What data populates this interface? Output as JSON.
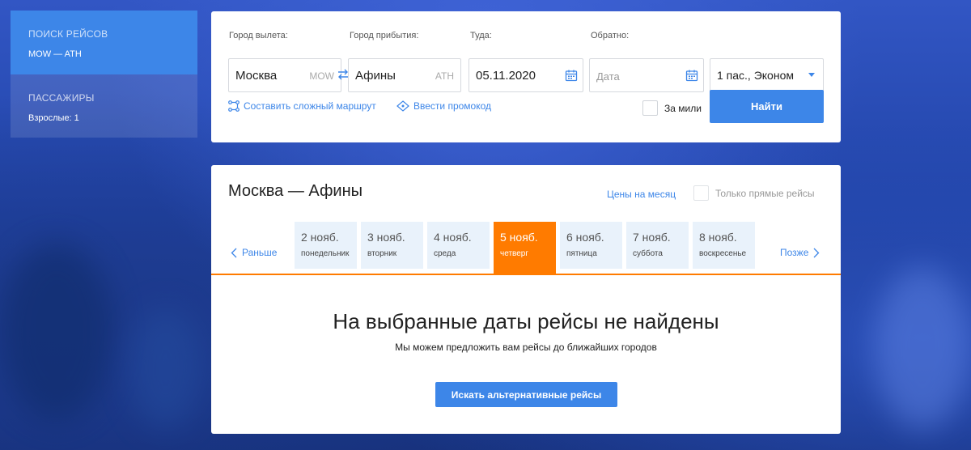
{
  "sidebar": {
    "search": {
      "title": "ПОИСК РЕЙСОВ",
      "route": "MOW — ATH"
    },
    "passengers": {
      "title": "ПАССАЖИРЫ",
      "adults": "Взрослые: 1"
    }
  },
  "search": {
    "from_label": "Город вылета:",
    "from_value": "Москва",
    "from_code": "MOW",
    "to_label": "Город прибытия:",
    "to_value": "Афины",
    "to_code": "ATH",
    "depart_label": "Туда:",
    "depart_value": "05.11.2020",
    "return_label": "Обратно:",
    "return_placeholder": "Дата",
    "passengers_value": "1 пас., Эконом",
    "complex_route_link": "Составить сложный маршрут",
    "promo_link": "Ввести промокод",
    "miles_label": "За мили",
    "find_button": "Найти"
  },
  "results": {
    "route_title": "Москва — Афины",
    "month_prices_link": "Цены на месяц",
    "direct_only_label": "Только прямые рейсы",
    "prev_label": "Раньше",
    "next_label": "Позже",
    "dates": [
      {
        "date": "2 нояб.",
        "weekday": "понедельник"
      },
      {
        "date": "3 нояб.",
        "weekday": "вторник"
      },
      {
        "date": "4 нояб.",
        "weekday": "среда"
      },
      {
        "date": "5 нояб.",
        "weekday": "четверг"
      },
      {
        "date": "6 нояб.",
        "weekday": "пятница"
      },
      {
        "date": "7 нояб.",
        "weekday": "суббота"
      },
      {
        "date": "8 нояб.",
        "weekday": "воскресенье"
      }
    ],
    "selected_index": 3,
    "empty_title": "На выбранные даты рейсы не найдены",
    "empty_subtitle": "Мы можем предложить вам рейсы до ближайших городов",
    "alt_button": "Искать альтернативные рейсы"
  },
  "colors": {
    "accent": "#3d86e8",
    "selected": "#ff7b00"
  }
}
